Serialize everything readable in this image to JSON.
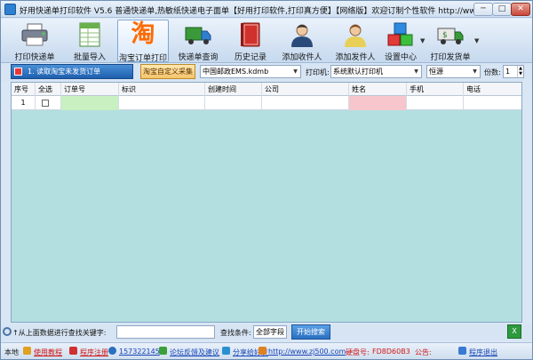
{
  "title": "好用快递单打印软件 V5.6 普通快递单,热敏纸快递电子面单【好用打印软件,打印真方便】【网络版】欢迎订制个性软件   http://www.zj500.com/",
  "window_buttons": {
    "min": "─",
    "max": "□",
    "close": "✕"
  },
  "toolbar": [
    {
      "label": "打印快递单",
      "icon": "printer-icon"
    },
    {
      "label": "批量导入",
      "icon": "spreadsheet-icon"
    },
    {
      "label": "淘宝订单打印",
      "icon": "taobao-icon",
      "glyph": "淘"
    },
    {
      "label": "快递单查询",
      "icon": "truck-icon"
    },
    {
      "label": "历史记录",
      "icon": "book-icon"
    },
    {
      "label": "添加收件人",
      "icon": "user-male-icon"
    },
    {
      "label": "添加发件人",
      "icon": "user-female-icon"
    },
    {
      "label": "设置中心",
      "icon": "cubes-icon"
    },
    {
      "label": "打印发货单",
      "icon": "delivery-truck-icon"
    }
  ],
  "options": {
    "read_button": "1. 读取淘宝未发货订单",
    "custom_button": "淘宝自定义采集",
    "template_select": "中国邮政EMS.kdmb",
    "printer_label": "打印机:",
    "printer_select": "系统默认打印机",
    "paper_select": "恒源",
    "copies_label": "份数:",
    "copies_value": "1"
  },
  "table": {
    "columns": [
      "序号",
      "全选",
      "订单号",
      "标识",
      "创建时间",
      "公司",
      "姓名",
      "手机",
      "电话"
    ],
    "rows": [
      {
        "index": "1"
      }
    ]
  },
  "search": {
    "label": "↑从上面数据进行查找关键字:",
    "condition_label": "查找条件:",
    "condition_value": "全部字段",
    "search_button": "开始搜索"
  },
  "status": {
    "local": "本地",
    "tutorial": "使用教程",
    "register": "程序注册",
    "qq": "157322145",
    "forum": "论坛反馈及建议",
    "share": "分享给好友",
    "url": "http://www.zj500.com",
    "disk_label": "硬盘号:",
    "disk_value": "FD8D60B3",
    "notice": "公告:",
    "exit": "程序退出"
  },
  "colors": {
    "selected_row_name": "#f7c6cc",
    "selected_row_order": "#c8f0c0",
    "grid_bg": "#b3dfe0"
  }
}
